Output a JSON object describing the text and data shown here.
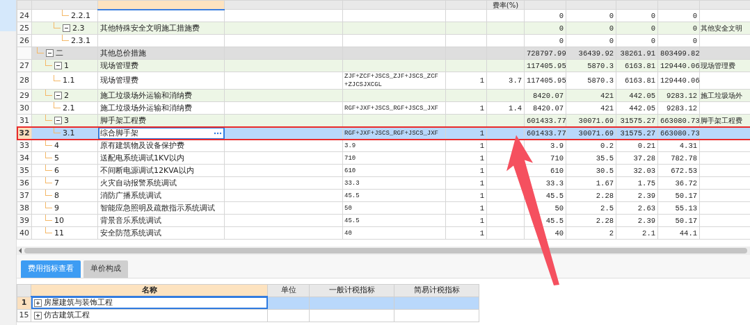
{
  "table": {
    "rate_header": "费率(%)",
    "continued_children": [
      {
        "number": "24",
        "code": "2.2.1",
        "kind": "item",
        "amounts": [
          "0",
          "0",
          "0",
          "0"
        ],
        "selected": false,
        "highlighted": false
      }
    ],
    "continued_rows": [
      {
        "number": "25",
        "code": "2.3",
        "name": "其他特殊安全文明施工措施费",
        "kind": "group",
        "expanded": true,
        "amounts": [
          "0",
          "0",
          "0",
          "0"
        ],
        "remark": "其他安全文明",
        "selected": false,
        "highlighted": false,
        "children": [
          {
            "number": "26",
            "code": "2.3.1",
            "kind": "item",
            "amounts": [
              "0",
              "0",
              "0",
              "0"
            ],
            "selected": false,
            "highlighted": false
          }
        ]
      }
    ],
    "rows": [
      {
        "code": "二",
        "name": "其他总价措施",
        "kind": "section",
        "expanded": true,
        "amounts": [
          "728797.99",
          "36439.92",
          "38261.91",
          "803499.82"
        ],
        "selected": false,
        "highlighted": false,
        "children": [
          {
            "number": "27",
            "code": "1",
            "name": "现场管理费",
            "kind": "group",
            "expanded": true,
            "amounts": [
              "117405.95",
              "5870.3",
              "6163.81",
              "129440.06"
            ],
            "remark": "现场管理费",
            "selected": false,
            "highlighted": false,
            "children": [
              {
                "number": "28",
                "code": "1.1",
                "name": "现场管理费",
                "kind": "item",
                "formula": "ZJF+ZCF+JSCS_ZJF+JSCS_ZCF +ZJCSJXCGL",
                "qty": "1",
                "rate": "3.7",
                "amounts": [
                  "117405.95",
                  "5870.3",
                  "6163.81",
                  "129440.06"
                ],
                "selected": false,
                "highlighted": false
              }
            ]
          },
          {
            "number": "29",
            "code": "2",
            "name": "施工垃圾场外运输和消纳费",
            "kind": "group",
            "expanded": true,
            "amounts": [
              "8420.07",
              "421",
              "442.05",
              "9283.12"
            ],
            "remark": "施工垃圾场外",
            "selected": false,
            "highlighted": false,
            "children": [
              {
                "number": "30",
                "code": "2.1",
                "name": "施工垃圾场外运输和消纳费",
                "kind": "item",
                "formula": "RGF+JXF+JSCS_RGF+JSCS_JXF",
                "qty": "1",
                "rate": "1.4",
                "amounts": [
                  "8420.07",
                  "421",
                  "442.05",
                  "9283.12"
                ],
                "selected": false,
                "highlighted": false
              }
            ]
          },
          {
            "number": "31",
            "code": "3",
            "name": "脚手架工程费",
            "kind": "group",
            "expanded": true,
            "amounts": [
              "601433.77",
              "30071.69",
              "31575.27",
              "663080.73"
            ],
            "remark": "脚手架工程费",
            "selected": false,
            "highlighted": false,
            "children": [
              {
                "number": "32",
                "code": "3.1",
                "name": "综合脚手架",
                "kind": "item",
                "formula": "RGF+JXF+JSCS_RGF+JSCS_JXF",
                "qty": "1",
                "amounts": [
                  "601433.77",
                  "30071.69",
                  "31575.27",
                  "663080.73"
                ],
                "selected": true,
                "highlighted": true
              }
            ]
          },
          {
            "number": "33",
            "code": "4",
            "name": "原有建筑物及设备保护费",
            "kind": "item",
            "formula": "3.9",
            "qty": "1",
            "amounts": [
              "3.9",
              "0.2",
              "0.21",
              "4.31"
            ],
            "selected": false,
            "highlighted": false
          },
          {
            "number": "34",
            "code": "5",
            "name": "送配电系统调试1KV以内",
            "kind": "item",
            "formula": "710",
            "qty": "1",
            "amounts": [
              "710",
              "35.5",
              "37.28",
              "782.78"
            ],
            "selected": false,
            "highlighted": false
          },
          {
            "number": "35",
            "code": "6",
            "name": "不间断电源调试12KVA以内",
            "kind": "item",
            "formula": "610",
            "qty": "1",
            "amounts": [
              "610",
              "30.5",
              "32.03",
              "672.53"
            ],
            "selected": false,
            "highlighted": false
          },
          {
            "number": "36",
            "code": "7",
            "name": "火灾自动报警系统调试",
            "kind": "item",
            "formula": "33.3",
            "qty": "1",
            "amounts": [
              "33.3",
              "1.67",
              "1.75",
              "36.72"
            ],
            "selected": false,
            "highlighted": false
          },
          {
            "number": "37",
            "code": "8",
            "name": "消防广播系统调试",
            "kind": "item",
            "formula": "45.5",
            "qty": "1",
            "amounts": [
              "45.5",
              "2.28",
              "2.39",
              "50.17"
            ],
            "selected": false,
            "highlighted": false
          },
          {
            "number": "38",
            "code": "9",
            "name": "智能应急照明及疏散指示系统调试",
            "kind": "item",
            "formula": "50",
            "qty": "1",
            "amounts": [
              "50",
              "2.5",
              "2.63",
              "55.13"
            ],
            "selected": false,
            "highlighted": false
          },
          {
            "number": "39",
            "code": "10",
            "name": "背景音乐系统调试",
            "kind": "item",
            "formula": "45.5",
            "qty": "1",
            "amounts": [
              "45.5",
              "2.28",
              "2.39",
              "50.17"
            ],
            "selected": false,
            "highlighted": false
          },
          {
            "number": "40",
            "code": "11",
            "name": "安全防范系统调试",
            "kind": "item",
            "formula": "40",
            "qty": "1",
            "amounts": [
              "40",
              "2",
              "2.1",
              "44.1"
            ],
            "selected": false,
            "highlighted": false
          }
        ]
      }
    ]
  },
  "annotation": {
    "kind": "arrow"
  },
  "bottom_tabs": [
    {
      "label": "费用指标查看",
      "selected": true
    },
    {
      "label": "单价构成",
      "selected": false
    }
  ],
  "index_table": {
    "columns": [
      "名称",
      "单位",
      "一般计税指标",
      "简易计税指标"
    ],
    "rows": [
      {
        "number": "1",
        "name": "房屋建筑与装饰工程",
        "expanded": false,
        "selected": true
      },
      {
        "number": "15",
        "name": "仿古建筑工程",
        "expanded": false,
        "selected": false
      }
    ]
  }
}
